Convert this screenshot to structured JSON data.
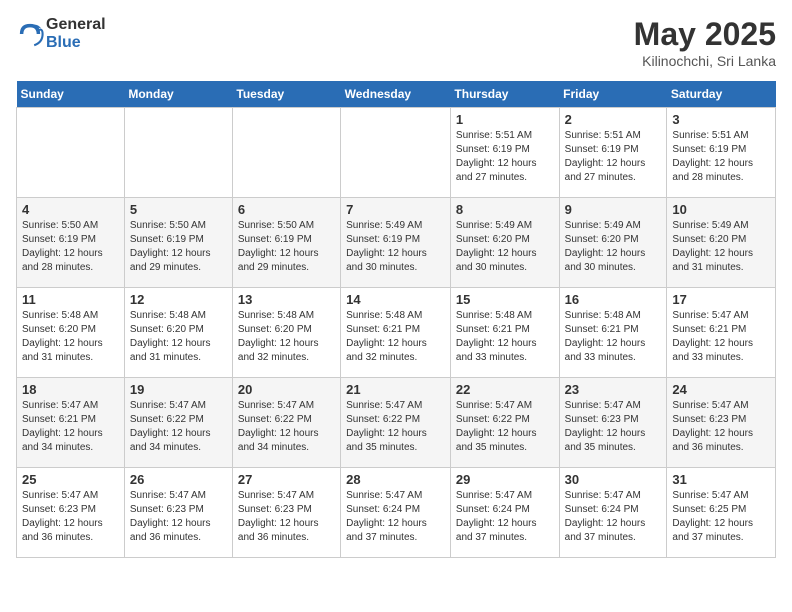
{
  "logo": {
    "text_general": "General",
    "text_blue": "Blue"
  },
  "title": "May 2025",
  "subtitle": "Kilinochchi, Sri Lanka",
  "weekdays": [
    "Sunday",
    "Monday",
    "Tuesday",
    "Wednesday",
    "Thursday",
    "Friday",
    "Saturday"
  ],
  "weeks": [
    [
      {
        "day": "",
        "info": ""
      },
      {
        "day": "",
        "info": ""
      },
      {
        "day": "",
        "info": ""
      },
      {
        "day": "",
        "info": ""
      },
      {
        "day": "1",
        "info": "Sunrise: 5:51 AM\nSunset: 6:19 PM\nDaylight: 12 hours\nand 27 minutes."
      },
      {
        "day": "2",
        "info": "Sunrise: 5:51 AM\nSunset: 6:19 PM\nDaylight: 12 hours\nand 27 minutes."
      },
      {
        "day": "3",
        "info": "Sunrise: 5:51 AM\nSunset: 6:19 PM\nDaylight: 12 hours\nand 28 minutes."
      }
    ],
    [
      {
        "day": "4",
        "info": "Sunrise: 5:50 AM\nSunset: 6:19 PM\nDaylight: 12 hours\nand 28 minutes."
      },
      {
        "day": "5",
        "info": "Sunrise: 5:50 AM\nSunset: 6:19 PM\nDaylight: 12 hours\nand 29 minutes."
      },
      {
        "day": "6",
        "info": "Sunrise: 5:50 AM\nSunset: 6:19 PM\nDaylight: 12 hours\nand 29 minutes."
      },
      {
        "day": "7",
        "info": "Sunrise: 5:49 AM\nSunset: 6:19 PM\nDaylight: 12 hours\nand 30 minutes."
      },
      {
        "day": "8",
        "info": "Sunrise: 5:49 AM\nSunset: 6:20 PM\nDaylight: 12 hours\nand 30 minutes."
      },
      {
        "day": "9",
        "info": "Sunrise: 5:49 AM\nSunset: 6:20 PM\nDaylight: 12 hours\nand 30 minutes."
      },
      {
        "day": "10",
        "info": "Sunrise: 5:49 AM\nSunset: 6:20 PM\nDaylight: 12 hours\nand 31 minutes."
      }
    ],
    [
      {
        "day": "11",
        "info": "Sunrise: 5:48 AM\nSunset: 6:20 PM\nDaylight: 12 hours\nand 31 minutes."
      },
      {
        "day": "12",
        "info": "Sunrise: 5:48 AM\nSunset: 6:20 PM\nDaylight: 12 hours\nand 31 minutes."
      },
      {
        "day": "13",
        "info": "Sunrise: 5:48 AM\nSunset: 6:20 PM\nDaylight: 12 hours\nand 32 minutes."
      },
      {
        "day": "14",
        "info": "Sunrise: 5:48 AM\nSunset: 6:21 PM\nDaylight: 12 hours\nand 32 minutes."
      },
      {
        "day": "15",
        "info": "Sunrise: 5:48 AM\nSunset: 6:21 PM\nDaylight: 12 hours\nand 33 minutes."
      },
      {
        "day": "16",
        "info": "Sunrise: 5:48 AM\nSunset: 6:21 PM\nDaylight: 12 hours\nand 33 minutes."
      },
      {
        "day": "17",
        "info": "Sunrise: 5:47 AM\nSunset: 6:21 PM\nDaylight: 12 hours\nand 33 minutes."
      }
    ],
    [
      {
        "day": "18",
        "info": "Sunrise: 5:47 AM\nSunset: 6:21 PM\nDaylight: 12 hours\nand 34 minutes."
      },
      {
        "day": "19",
        "info": "Sunrise: 5:47 AM\nSunset: 6:22 PM\nDaylight: 12 hours\nand 34 minutes."
      },
      {
        "day": "20",
        "info": "Sunrise: 5:47 AM\nSunset: 6:22 PM\nDaylight: 12 hours\nand 34 minutes."
      },
      {
        "day": "21",
        "info": "Sunrise: 5:47 AM\nSunset: 6:22 PM\nDaylight: 12 hours\nand 35 minutes."
      },
      {
        "day": "22",
        "info": "Sunrise: 5:47 AM\nSunset: 6:22 PM\nDaylight: 12 hours\nand 35 minutes."
      },
      {
        "day": "23",
        "info": "Sunrise: 5:47 AM\nSunset: 6:23 PM\nDaylight: 12 hours\nand 35 minutes."
      },
      {
        "day": "24",
        "info": "Sunrise: 5:47 AM\nSunset: 6:23 PM\nDaylight: 12 hours\nand 36 minutes."
      }
    ],
    [
      {
        "day": "25",
        "info": "Sunrise: 5:47 AM\nSunset: 6:23 PM\nDaylight: 12 hours\nand 36 minutes."
      },
      {
        "day": "26",
        "info": "Sunrise: 5:47 AM\nSunset: 6:23 PM\nDaylight: 12 hours\nand 36 minutes."
      },
      {
        "day": "27",
        "info": "Sunrise: 5:47 AM\nSunset: 6:23 PM\nDaylight: 12 hours\nand 36 minutes."
      },
      {
        "day": "28",
        "info": "Sunrise: 5:47 AM\nSunset: 6:24 PM\nDaylight: 12 hours\nand 37 minutes."
      },
      {
        "day": "29",
        "info": "Sunrise: 5:47 AM\nSunset: 6:24 PM\nDaylight: 12 hours\nand 37 minutes."
      },
      {
        "day": "30",
        "info": "Sunrise: 5:47 AM\nSunset: 6:24 PM\nDaylight: 12 hours\nand 37 minutes."
      },
      {
        "day": "31",
        "info": "Sunrise: 5:47 AM\nSunset: 6:25 PM\nDaylight: 12 hours\nand 37 minutes."
      }
    ]
  ]
}
